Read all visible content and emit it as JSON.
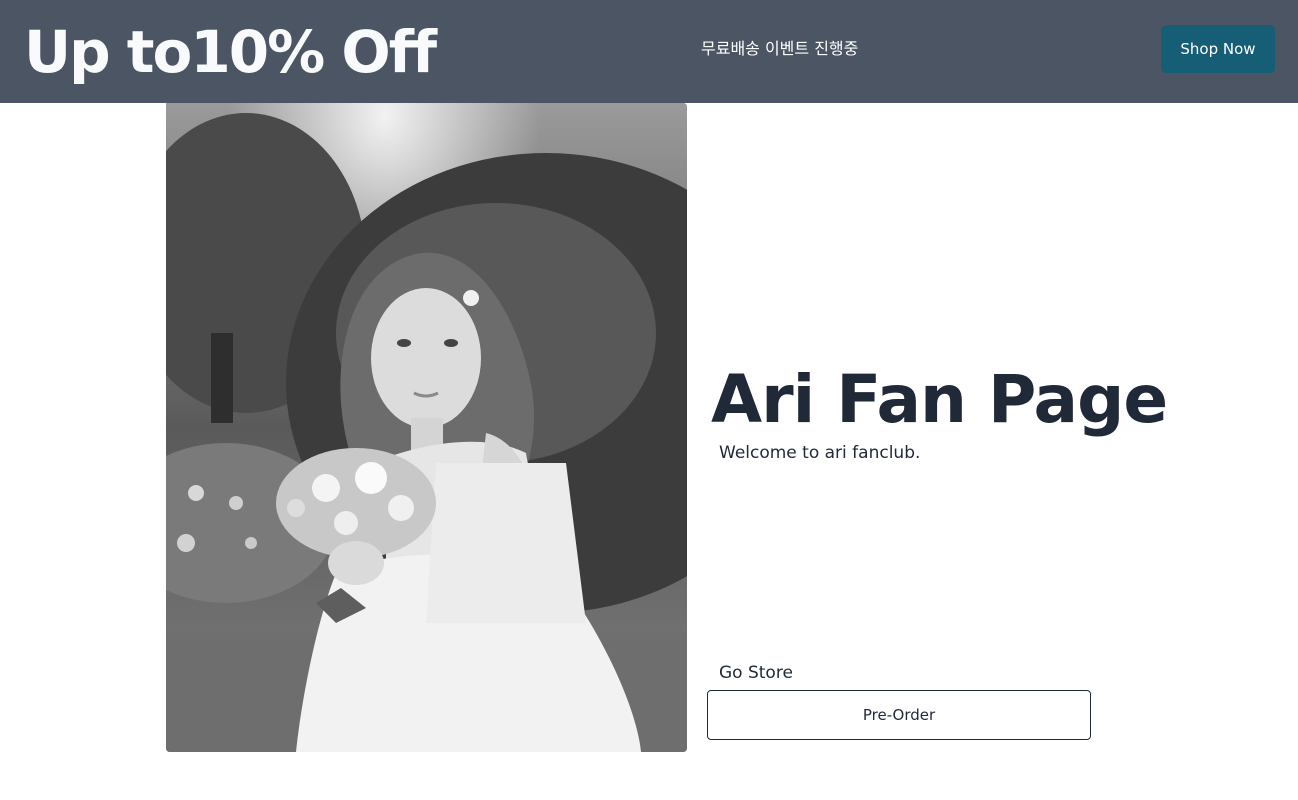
{
  "promo": {
    "headline": "Up to10% Off",
    "message": "무료배송 이벤트 진행중",
    "button_label": "Shop Now",
    "background": "#4b5563",
    "button_color": "#155e75"
  },
  "hero": {
    "image_alt": "Black and white photo of a girl in a white dress holding a flower bouquet in a garden",
    "title": "Ari Fan Page",
    "subtitle": "Welcome to ari fanclub.",
    "store_label": "Go Store",
    "preorder_label": "Pre-Order",
    "text_color": "#1f2937"
  }
}
